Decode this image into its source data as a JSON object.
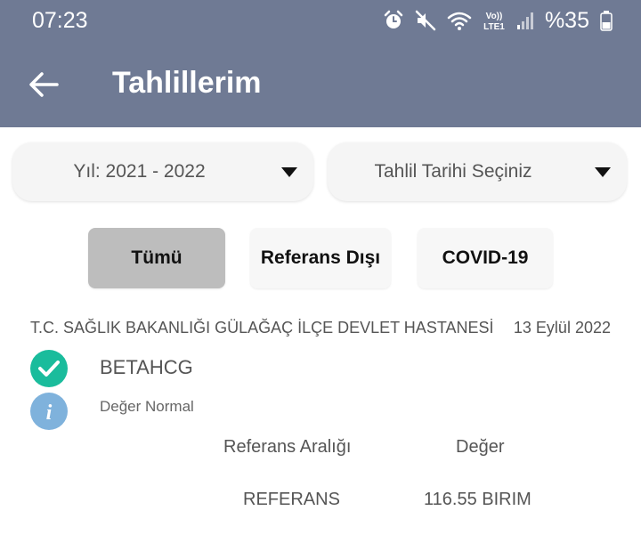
{
  "status_bar": {
    "time": "07:23",
    "battery": "%35",
    "icons": [
      "alarm-icon",
      "mute-icon",
      "wifi-icon",
      "volte-icon",
      "signal-icon",
      "battery-icon"
    ],
    "volte_top": "Vo))",
    "volte_bottom": "LTE1"
  },
  "app_bar": {
    "title": "Tahlillerim",
    "back_icon": "arrow-left-icon",
    "background": "#6f7a94"
  },
  "filters": {
    "year": "Yıl: 2021 - 2022",
    "date_placeholder": "Tahlil Tarihi Seçiniz"
  },
  "tabs": [
    {
      "label": "Tümü",
      "selected": true
    },
    {
      "label": "Referans Dışı",
      "selected": false
    },
    {
      "label": "COVID-19",
      "selected": false
    }
  ],
  "result": {
    "hospital": "T.C. SAĞLIK BAKANLIĞI GÜLAĞAÇ İLÇE DEVLET HASTANESİ",
    "date": "13 Eylül 2022",
    "test_name": "BETAHCG",
    "status": "Değer Normal",
    "check_color": "#1abc9c",
    "info_color": "#7fb2dc",
    "columns": [
      "Referans Aralığı",
      "Değer"
    ],
    "row": [
      "REFERANS",
      "116.55 BIRIM"
    ]
  }
}
